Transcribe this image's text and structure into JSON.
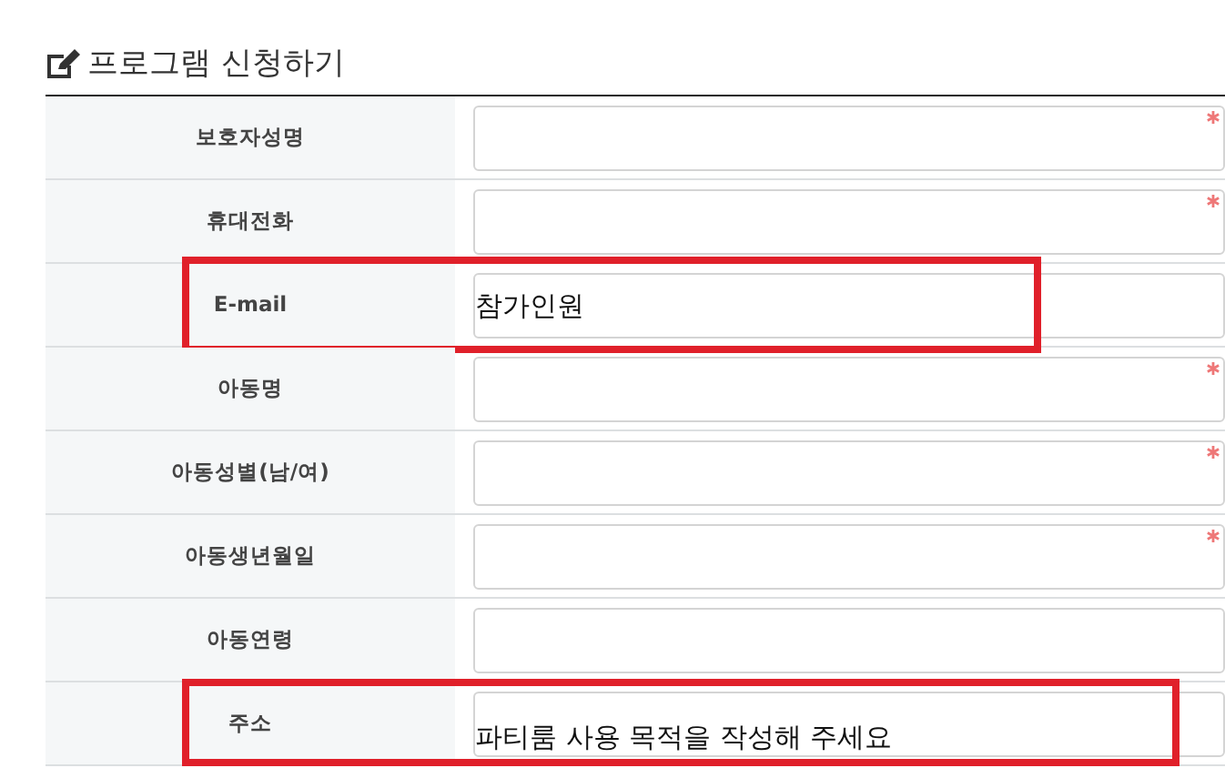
{
  "title": "프로그램 신청하기",
  "rows": [
    {
      "label": "보호자성명",
      "required": true,
      "highlighted": false
    },
    {
      "label": "휴대전화",
      "required": true,
      "highlighted": false
    },
    {
      "label": "E-mail",
      "required": false,
      "highlighted": true,
      "value": "참가인원"
    },
    {
      "label": "아동명",
      "required": true,
      "highlighted": false
    },
    {
      "label": "아동성별(남/여)",
      "required": true,
      "highlighted": false
    },
    {
      "label": "아동생년월일",
      "required": true,
      "highlighted": false
    },
    {
      "label": "아동연령",
      "required": false,
      "highlighted": false
    },
    {
      "label": "주소",
      "required": false,
      "highlighted": true,
      "value": "파티룸 사용 목적을 작성해 주세요"
    }
  ]
}
